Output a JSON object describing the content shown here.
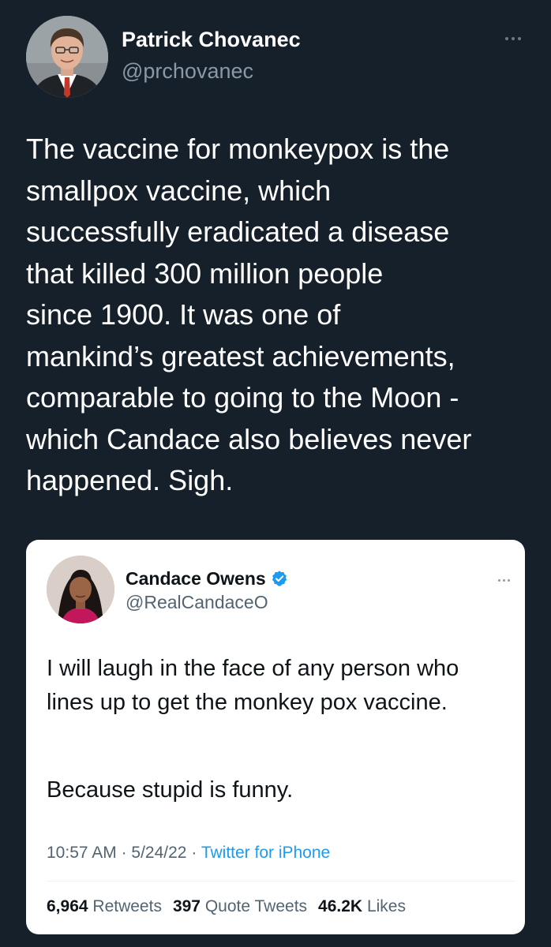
{
  "outer_tweet": {
    "author_name": "Patrick Chovanec",
    "handle": "@prchovanec",
    "more_icon": "more-horizontal-icon",
    "text_lines": [
      "The vaccine for monkeypox is the",
      "smallpox vaccine, which",
      "successfully eradicated a disease",
      "that killed 300 million people",
      "since 1900. It was one of",
      "mankind’s greatest achievements,",
      "comparable to going to the Moon -",
      "which Candace also believes never",
      "happened. Sigh."
    ]
  },
  "quoted_tweet": {
    "author_name": "Candace Owens",
    "handle": "@RealCandaceO",
    "verified_icon": "verified-badge-icon",
    "text_paragraph_1": "I will laugh in the face of any person who lines up to get the monkey pox vaccine.",
    "text_paragraph_2": "Because stupid is funny.",
    "time": "10:57 AM",
    "separator": "·",
    "date": "5/24/22",
    "source": "Twitter for iPhone",
    "retweets_count": "6,964",
    "retweets_label": "Retweets",
    "quote_tweets_count": "397",
    "quote_tweets_label": "Quote Tweets",
    "likes_count": "46.2K",
    "likes_label": "Likes"
  },
  "colors": {
    "background": "#15202b",
    "primary_text": "#ffffff",
    "secondary_text": "#8b98a5",
    "card_background": "#ffffff",
    "card_text": "#0f1419",
    "card_secondary": "#536471",
    "accent": "#1d9bf0"
  }
}
